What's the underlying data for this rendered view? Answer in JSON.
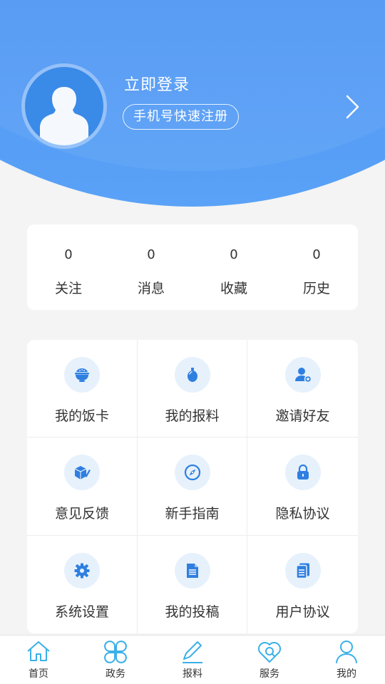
{
  "profile": {
    "login_label": "立即登录",
    "register_label": "手机号快速注册"
  },
  "stats": [
    {
      "value": "0",
      "label": "关注"
    },
    {
      "value": "0",
      "label": "消息"
    },
    {
      "value": "0",
      "label": "收藏"
    },
    {
      "value": "0",
      "label": "历史"
    }
  ],
  "menu": [
    {
      "label": "我的饭卡",
      "icon": "rice-bowl-icon"
    },
    {
      "label": "我的报料",
      "icon": "grenade-icon"
    },
    {
      "label": "邀请好友",
      "icon": "add-user-icon"
    },
    {
      "label": "意见反馈",
      "icon": "box-pencil-icon"
    },
    {
      "label": "新手指南",
      "icon": "compass-icon"
    },
    {
      "label": "隐私协议",
      "icon": "lock-icon"
    },
    {
      "label": "系统设置",
      "icon": "gear-icon"
    },
    {
      "label": "我的投稿",
      "icon": "document-icon"
    },
    {
      "label": "用户协议",
      "icon": "documents-icon"
    }
  ],
  "tabbar": [
    {
      "label": "首页",
      "icon": "home-icon"
    },
    {
      "label": "政务",
      "icon": "clover-icon"
    },
    {
      "label": "报料",
      "icon": "pencil-icon"
    },
    {
      "label": "服务",
      "icon": "heart-search-icon"
    },
    {
      "label": "我的",
      "icon": "person-icon"
    }
  ],
  "colors": {
    "header_blue": "#4b93f3",
    "icon_blue": "#2f7fe0",
    "icon_bg": "#e6f1fc",
    "tab_icon": "#3ab0e8"
  }
}
